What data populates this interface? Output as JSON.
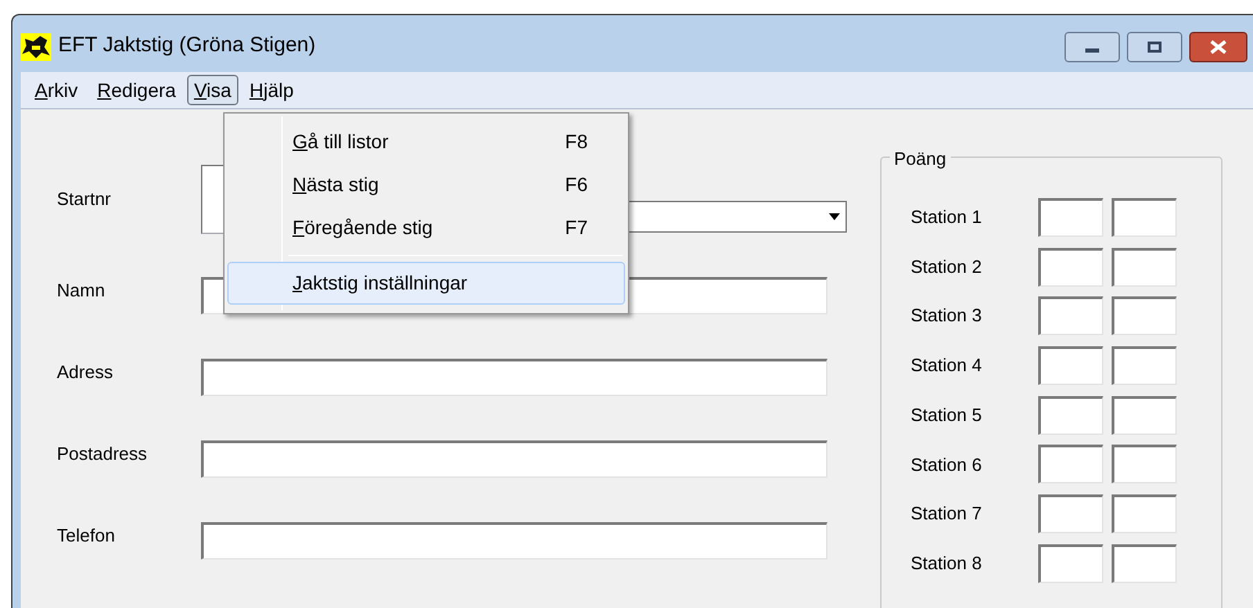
{
  "window": {
    "title": "EFT Jaktstig (Gröna Stigen)"
  },
  "menu_bar": [
    {
      "label": "Arkiv",
      "selected": false
    },
    {
      "label": "Redigera",
      "selected": false
    },
    {
      "label": "Visa",
      "selected": true
    },
    {
      "label": "Hjälp",
      "selected": false
    }
  ],
  "dropdown_menu": [
    {
      "kind": "item",
      "label": "Gå till listor",
      "shortcut": "F8",
      "selected": false
    },
    {
      "kind": "item",
      "label": "Nästa stig",
      "shortcut": "F6",
      "selected": false
    },
    {
      "kind": "item",
      "label": "Föregående stig",
      "shortcut": "F7",
      "selected": false
    },
    {
      "kind": "separator"
    },
    {
      "kind": "item",
      "label": "Jaktstig inställningar",
      "selected": true
    }
  ],
  "form": [
    {
      "kind": "combo",
      "label": "Startnr"
    },
    {
      "kind": "text",
      "label": "Namn"
    },
    {
      "kind": "text",
      "label": "Adress"
    },
    {
      "kind": "text",
      "label": "Postadress"
    },
    {
      "kind": "text",
      "label": "Telefon"
    }
  ],
  "points": {
    "title": "Poäng",
    "stations": [
      {
        "label": "Station 1"
      },
      {
        "label": "Station 2"
      },
      {
        "label": "Station 3"
      },
      {
        "label": "Station 4"
      },
      {
        "label": "Station 5"
      },
      {
        "label": "Station 6"
      },
      {
        "label": "Station 7"
      },
      {
        "label": "Station 8"
      }
    ]
  }
}
